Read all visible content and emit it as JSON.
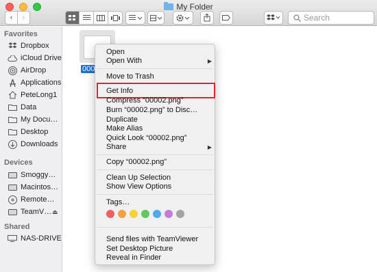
{
  "window": {
    "title": "My Folder"
  },
  "toolbar": {
    "search_placeholder": "Search",
    "icons": [
      "back-icon",
      "forward-icon",
      "icon-view-icon",
      "list-view-icon",
      "column-view-icon",
      "coverflow-icon",
      "arrange-icon",
      "action-gear-icon",
      "share-icon",
      "tag-icon",
      "dropbox-icon",
      "search-icon"
    ]
  },
  "sidebar": {
    "favorites_heading": "Favorites",
    "favorites": [
      {
        "label": "Dropbox",
        "icon": "dropbox-icon"
      },
      {
        "label": "iCloud Drive",
        "icon": "cloud-icon"
      },
      {
        "label": "AirDrop",
        "icon": "airdrop-icon"
      },
      {
        "label": "Applications",
        "icon": "applications-icon"
      },
      {
        "label": "PeteLong1",
        "icon": "home-icon"
      },
      {
        "label": "Data",
        "icon": "folder-icon"
      },
      {
        "label": "My Docu…",
        "icon": "folder-icon"
      },
      {
        "label": "Desktop",
        "icon": "folder-icon"
      },
      {
        "label": "Downloads",
        "icon": "downloads-icon"
      }
    ],
    "devices_heading": "Devices",
    "devices": [
      {
        "label": "Smoggy…",
        "icon": "drive-icon"
      },
      {
        "label": "Macintos…",
        "icon": "drive-icon"
      },
      {
        "label": "Remote…",
        "icon": "disc-icon"
      },
      {
        "label": "TeamV…",
        "icon": "drive-icon"
      }
    ],
    "shared_heading": "Shared",
    "shared": [
      {
        "label": "NAS-DRIVE",
        "icon": "server-icon"
      }
    ]
  },
  "file": {
    "label": "0000"
  },
  "context_menu": {
    "items": [
      {
        "label": "Open"
      },
      {
        "label": "Open With",
        "submenu": true
      },
      {
        "label": "Move to Trash"
      },
      {
        "label": "Get Info",
        "highlighted": true
      },
      {
        "label": "Compress “00002.png”"
      },
      {
        "label": "Burn “00002.png” to Disc…"
      },
      {
        "label": "Duplicate"
      },
      {
        "label": "Make Alias"
      },
      {
        "label": "Quick Look “00002.png”"
      },
      {
        "label": "Share",
        "submenu": true
      },
      {
        "label": "Copy “00002.png”"
      },
      {
        "label": "Clean Up Selection"
      },
      {
        "label": "Show View Options"
      },
      {
        "label": "Tags…"
      },
      {
        "label": "Send files with TeamViewer"
      },
      {
        "label": "Set Desktop Picture"
      },
      {
        "label": "Reveal in Finder"
      }
    ],
    "tag_colors": [
      "#ef5f5f",
      "#f5a03c",
      "#f5d13c",
      "#5fc95f",
      "#4ea9ef",
      "#c57ad9",
      "#a3a3a3"
    ],
    "highlight_color": "#e0242a"
  }
}
